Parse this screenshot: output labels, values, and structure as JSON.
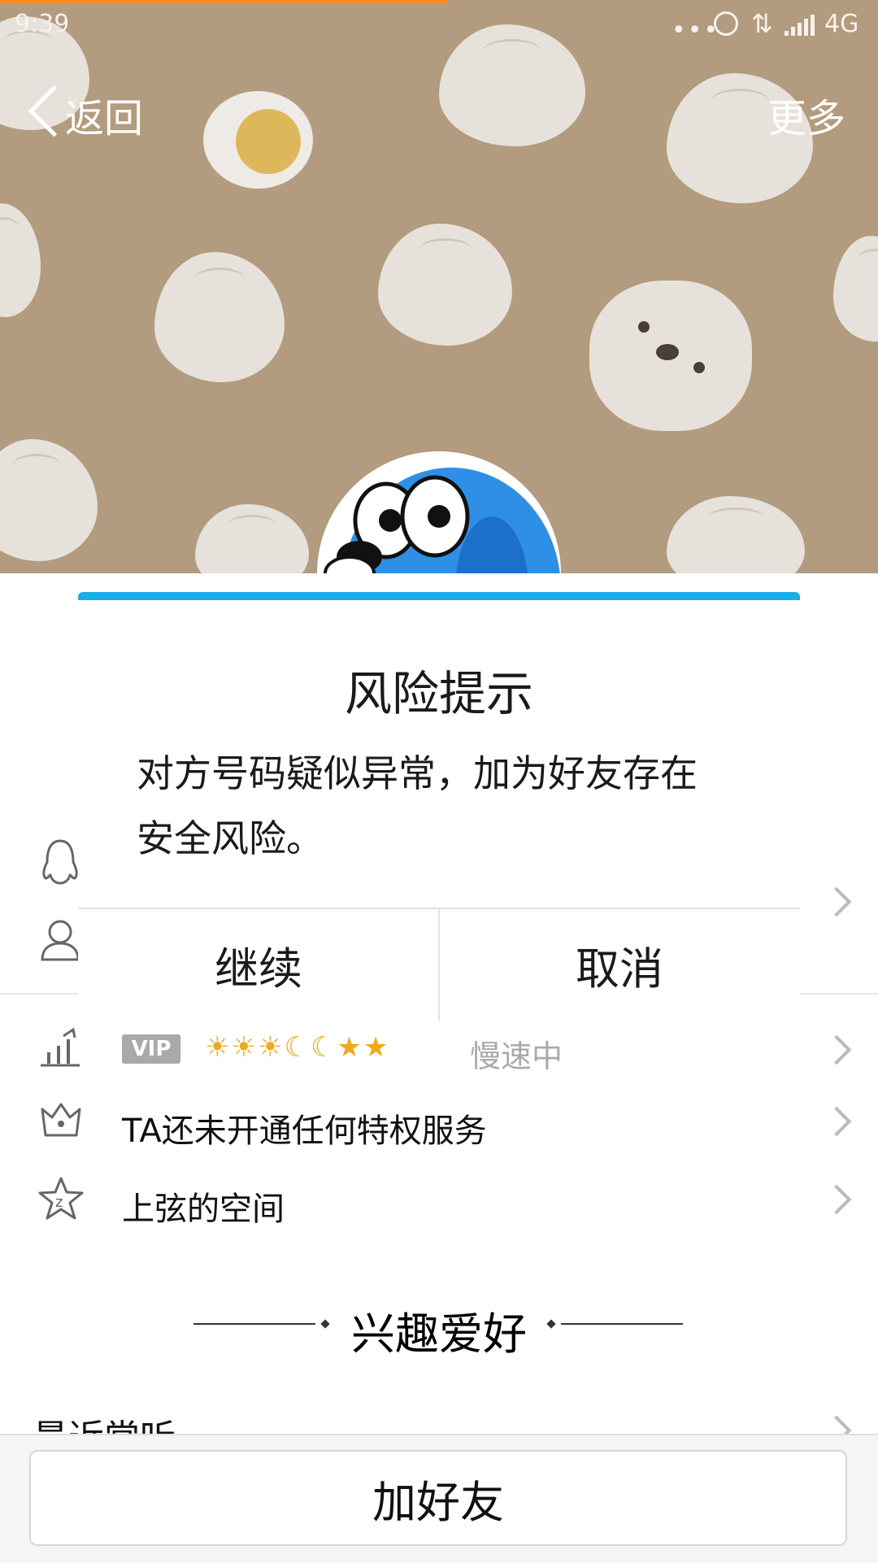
{
  "status_bar": {
    "time": "9:39",
    "network": "4G",
    "icons": [
      "more-dots-icon",
      "alarm-icon",
      "data-arrows-icon",
      "signal-icon"
    ],
    "load_progress": 0.51
  },
  "nav": {
    "back_label": "返回",
    "more_label": "更多"
  },
  "dialog": {
    "title": "风险提示",
    "message": "对方号码疑似异常，加为好友存在安全风险。",
    "continue_label": "继续",
    "cancel_label": "取消",
    "accent_color": "#1aaeea"
  },
  "profile": {
    "level_badge": "VIP",
    "level_icons": [
      "sun",
      "sun",
      "sun",
      "moon",
      "moon",
      "star",
      "star"
    ],
    "level_status": "慢速中",
    "privilege_text": "TA还未开通任何特权服务",
    "space_text": "上弦的空间"
  },
  "section": {
    "title": "兴趣爱好",
    "partial_row": "最近常听"
  },
  "bottom": {
    "add_friend_label": "加好友"
  }
}
